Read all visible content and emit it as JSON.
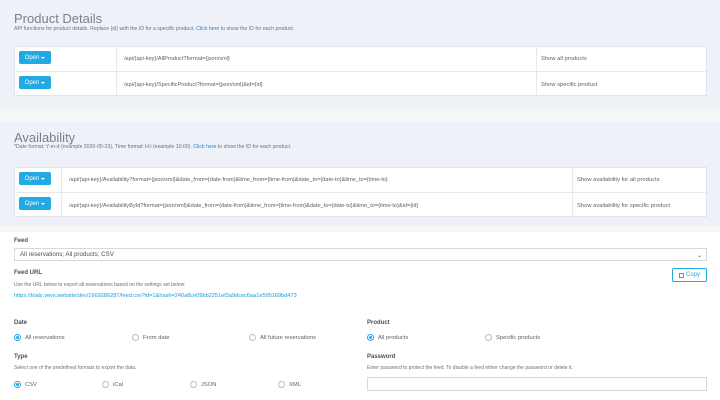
{
  "product_details": {
    "title": "Product Details",
    "desc_before": "API functions for product details. Replace {id} with the ID for a specific product. ",
    "desc_link": "Click here",
    "desc_after": " to show the ID for each product.",
    "rows": [
      {
        "button": "Open",
        "url": "/api/{api-key}/AllProduct?format={json/xml}",
        "desc": "Show all products"
      },
      {
        "button": "Open",
        "url": "/api/{api-key}/SpecificProduct?format={json/xml}&id={id}",
        "desc": "Show specific product"
      }
    ]
  },
  "availability": {
    "title": "Availability",
    "desc_before": "*Date format: Y-m-d (example 2020-05-23), Time format: H:i (example 10:00). ",
    "desc_link": "Click here",
    "desc_after": " to show the ID for each product.",
    "rows": [
      {
        "button": "Open",
        "url": "/api/{api-key}/Availability?format={json/xml}&date_from={date-from}&time_from={time-from}&date_to={date-to}&time_to={time-to}",
        "desc": "Show availability for all products"
      },
      {
        "button": "Open",
        "url": "/api/{api-key}/AvailabilityById?format={json/xml}&date_from={date-from}&time_from={time-from}&date_to={date-to}&time_to={time-to}&id={id}",
        "desc": "Show availability for specific product"
      }
    ]
  },
  "feed": {
    "label": "Feed",
    "selected": "All reservations; All products; CSV",
    "url_label": "Feed URL",
    "url_hint": "Use the URL below to export all reservations based on the settings set below.",
    "url": "https://trials.vevs.website/dev/1669286287/feed.csv?id=1&hash=240a8ce09bb2251ef3a9dcec6aa1e595169bd473",
    "copy_label": "Copy"
  },
  "date": {
    "label": "Date",
    "options": [
      "All reservations",
      "From date",
      "All future reservations"
    ],
    "selected_index": 0
  },
  "product": {
    "label": "Product",
    "options": [
      "All products",
      "Specific products"
    ],
    "selected_index": 0
  },
  "type": {
    "label": "Type",
    "hint": "Select one of the predefined formats to export the data.",
    "options": [
      "CSV",
      "iCal",
      "JSON",
      "XML"
    ],
    "selected_index": 0
  },
  "password": {
    "label": "Password",
    "hint": "Enter password to protect the feed. To disable a feed either change the password or delete it."
  },
  "colors": {
    "accent": "#21a9e1",
    "link": "#1a9bd7"
  }
}
